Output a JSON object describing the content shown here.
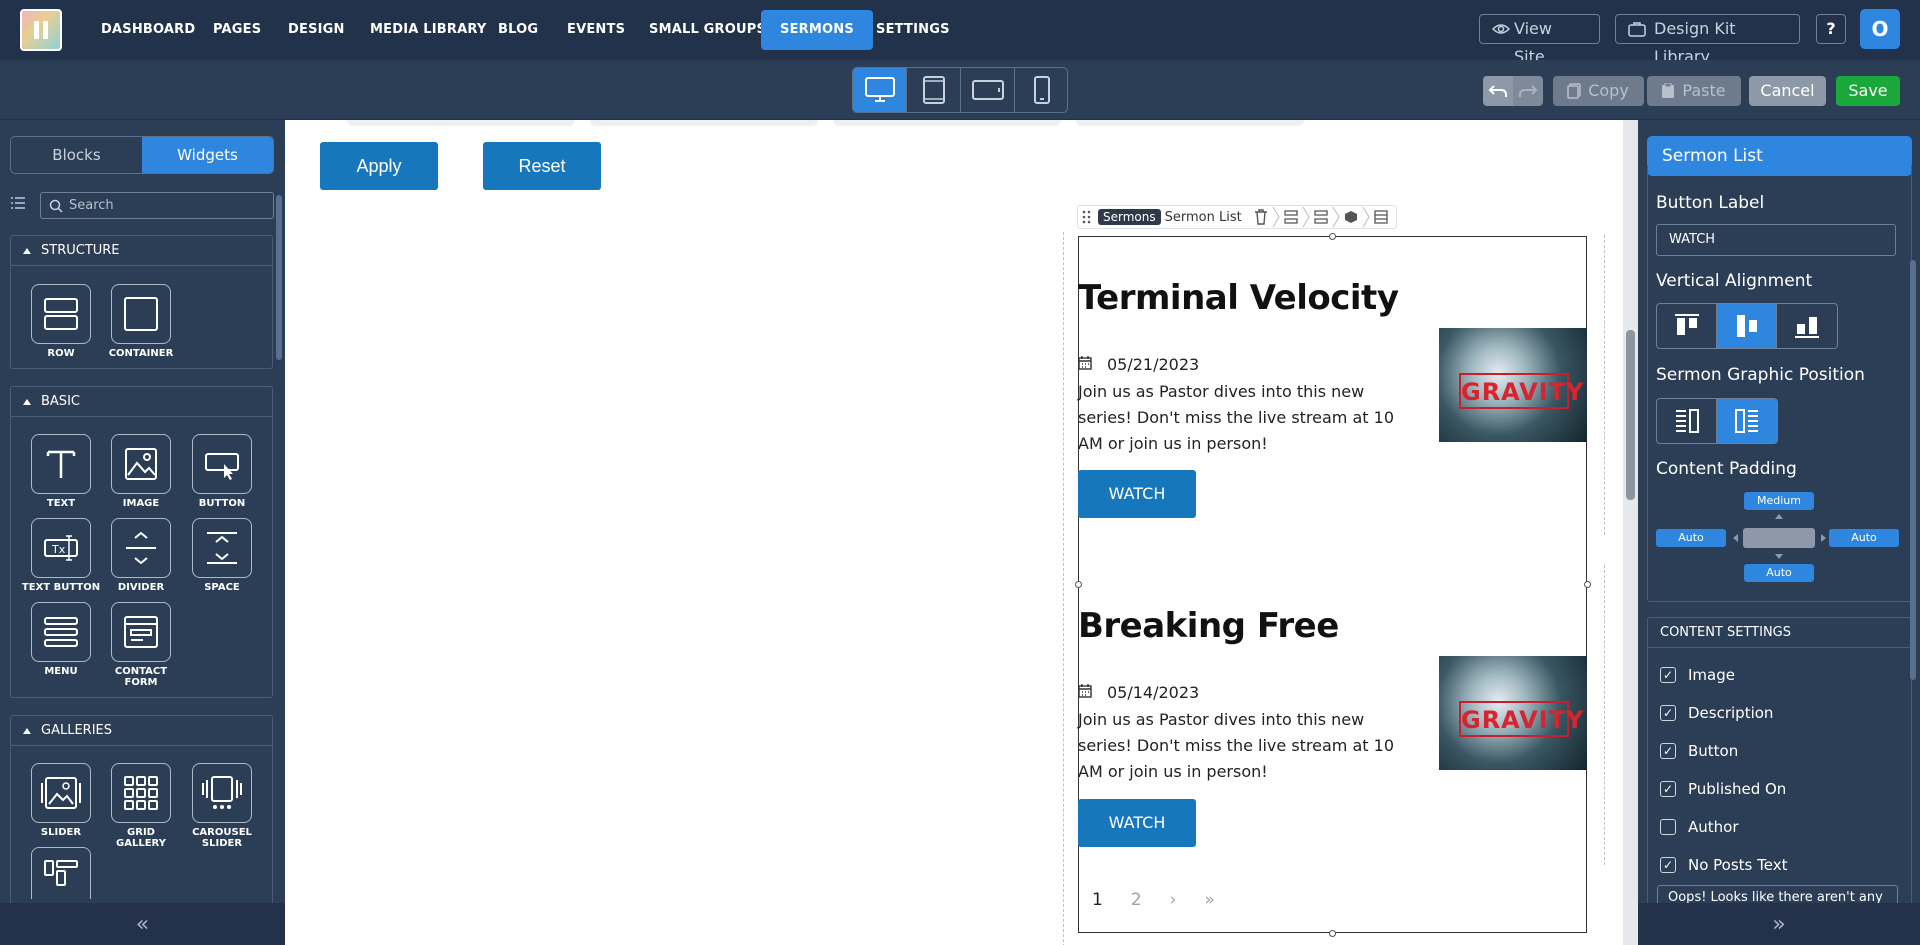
{
  "nav": {
    "items": [
      "DASHBOARD",
      "PAGES",
      "DESIGN",
      "MEDIA LIBRARY",
      "BLOG",
      "EVENTS",
      "SMALL GROUPS",
      "SERMONS",
      "SETTINGS"
    ],
    "active": "SERMONS",
    "view_site": "View Site",
    "design_kit": "Design Kit Library",
    "help": "?",
    "avatar": "O"
  },
  "toolbar": {
    "devices": [
      "desktop-icon",
      "tablet-portrait-icon",
      "tablet-landscape-icon",
      "mobile-icon"
    ],
    "active_device": "desktop",
    "copy": "Copy",
    "paste": "Paste",
    "cancel": "Cancel",
    "save": "Save"
  },
  "left": {
    "tabs": [
      "Blocks",
      "Widgets"
    ],
    "active_tab": "Widgets",
    "search_placeholder": "Search",
    "sections": {
      "structure": {
        "title": "STRUCTURE",
        "widgets": [
          "ROW",
          "CONTAINER"
        ]
      },
      "basic": {
        "title": "BASIC",
        "widgets": [
          "TEXT",
          "IMAGE",
          "BUTTON",
          "TEXT BUTTON",
          "DIVIDER",
          "SPACE",
          "MENU",
          "CONTACT FORM"
        ]
      },
      "galleries": {
        "title": "GALLERIES",
        "widgets": [
          "SLIDER",
          "GRID GALLERY",
          "CAROUSEL SLIDER"
        ]
      }
    },
    "collapse": "«"
  },
  "canvas": {
    "apply": "Apply",
    "reset": "Reset",
    "widget_tag": "Sermons",
    "widget_name": "Sermon List",
    "sermons": [
      {
        "title": "Terminal Velocity",
        "date": "05/21/2023",
        "description": "Join us as Pastor dives into this new series! Don't miss the live stream at 10 AM or join us in person!",
        "button": "WATCH",
        "image_text": "GRAVITY"
      },
      {
        "title": "Breaking Free",
        "date": "05/14/2023",
        "description": "Join us as Pastor dives into this new series! Don't miss the live stream at 10 AM or join us in person!",
        "button": "WATCH",
        "image_text": "GRAVITY"
      }
    ],
    "pager": {
      "current": "1",
      "next_page": "2",
      "next": "›",
      "last": "»"
    }
  },
  "right": {
    "title": "Sermon List",
    "button_label_title": "Button Label",
    "button_label_value": "WATCH",
    "vertical_alignment": "Vertical Alignment",
    "vertical_active": "middle",
    "graphic_position": "Sermon Graphic Position",
    "graphic_active": "right",
    "content_padding": "Content Padding",
    "padding": {
      "top": "Medium",
      "left": "Auto",
      "right": "Auto",
      "bottom": "Auto"
    },
    "content_settings": {
      "title": "CONTENT SETTINGS",
      "items": [
        {
          "label": "Image",
          "checked": true
        },
        {
          "label": "Description",
          "checked": true
        },
        {
          "label": "Button",
          "checked": true
        },
        {
          "label": "Published On",
          "checked": true
        },
        {
          "label": "Author",
          "checked": false
        },
        {
          "label": "No Posts Text",
          "checked": true
        }
      ],
      "no_posts_text_value": "Oops! Looks like there aren't any"
    },
    "collapse": "»"
  },
  "colors": {
    "accent": "#2e86de",
    "save": "#1aa83a",
    "canvas_button": "#1777bd",
    "panel_bg": "#2c3e55",
    "nav_bg": "#22324a"
  }
}
